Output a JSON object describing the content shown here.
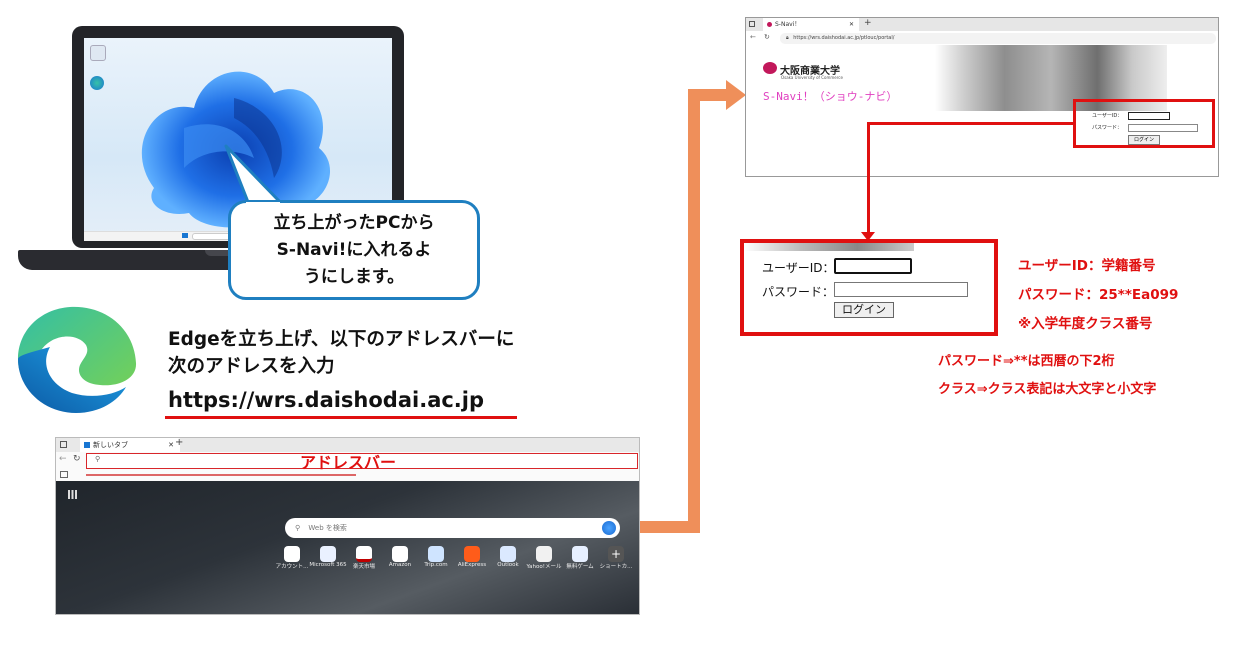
{
  "bubble": {
    "text": "立ち上がったPCから\nS-Navi!に入れるよ\nうにします。"
  },
  "instruction": {
    "line1": "Edgeを立ち上げ、以下のアドレスバーに",
    "line2": "次のアドレスを入力",
    "url": "https://wrs.daishodai.ac.jp"
  },
  "edge_browser": {
    "tab_label": "新しいタブ",
    "address_bar_label": "アドレスバー",
    "search_placeholder": "Web を検索",
    "quick_links": [
      "アカウント...",
      "Microsoft 365",
      "楽天市場",
      "Amazon",
      "Trip.com",
      "AliExpress",
      "Outlook",
      "Yahoo!メール",
      "無料ゲーム",
      "ショートカ..."
    ]
  },
  "portal_browser": {
    "tab_label": "S-Navi！",
    "address": "https://wrs.daishodai.ac.jp/ptlouc/portal/",
    "logo_text": "大阪商業大学",
    "logo_sub": "Osaka University of Commerce",
    "snavi_title": "S-Navi！（ショウ-ナビ）",
    "userid_label": "ユーザーID：",
    "password_label": "パスワード：",
    "login_button": "ログイン"
  },
  "login_zoom": {
    "userid_label": "ユーザーID：",
    "password_label": "パスワード：",
    "login_button": "ログイン"
  },
  "notes": {
    "userid": "ユーザーID：学籍番号",
    "password": "パスワード：25**Ea099",
    "class_note": "※入学年度クラス番号",
    "password_hint": "パスワード⇒**は西暦の下2桁",
    "class_hint": "クラス⇒クラス表記は大文字と小文字"
  },
  "colors": {
    "accent_red": "#e01010",
    "arrow_orange": "#ef8f5a",
    "bubble_border": "#1f7fc0"
  }
}
